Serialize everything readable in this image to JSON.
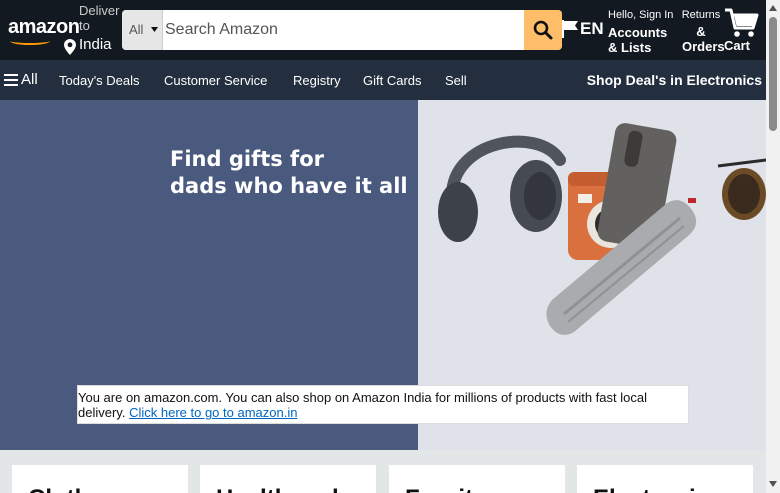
{
  "header": {
    "logo_text": "amazon",
    "deliver_line1": "Deliver",
    "deliver_line2": "to",
    "deliver_location": "India",
    "search": {
      "category": "All",
      "placeholder": "Search Amazon",
      "value": ""
    },
    "language": "EN",
    "account_hello": "Hello, Sign In",
    "account_line1": "Accounts",
    "account_line2": "& Lists",
    "returns_line1": "Returns",
    "returns_line2": "&",
    "returns_line3": "Orders",
    "cart_label": "Cart",
    "brand_accent": "#febd69",
    "background": "#131921"
  },
  "subnav": {
    "all_label": "All",
    "links": [
      "Today's Deals",
      "Customer Service",
      "Registry",
      "Gift Cards",
      "Sell"
    ],
    "promo": "Shop Deal's in Electronics",
    "background": "#232f3e"
  },
  "hero": {
    "headline_line1": "Find gifts for",
    "headline_line2": "dads who have it all",
    "panel_color": "#4a5a7e"
  },
  "notice": {
    "text": "You are on amazon.com. You can also shop on Amazon India for millions of products with fast local delivery.",
    "link_text": "Click here to go to amazon.in",
    "link_color": "#0066c0"
  },
  "cards": [
    {
      "title": "Clothes"
    },
    {
      "title": "Health and"
    },
    {
      "title": "Furniture"
    },
    {
      "title": "Electronics"
    }
  ]
}
